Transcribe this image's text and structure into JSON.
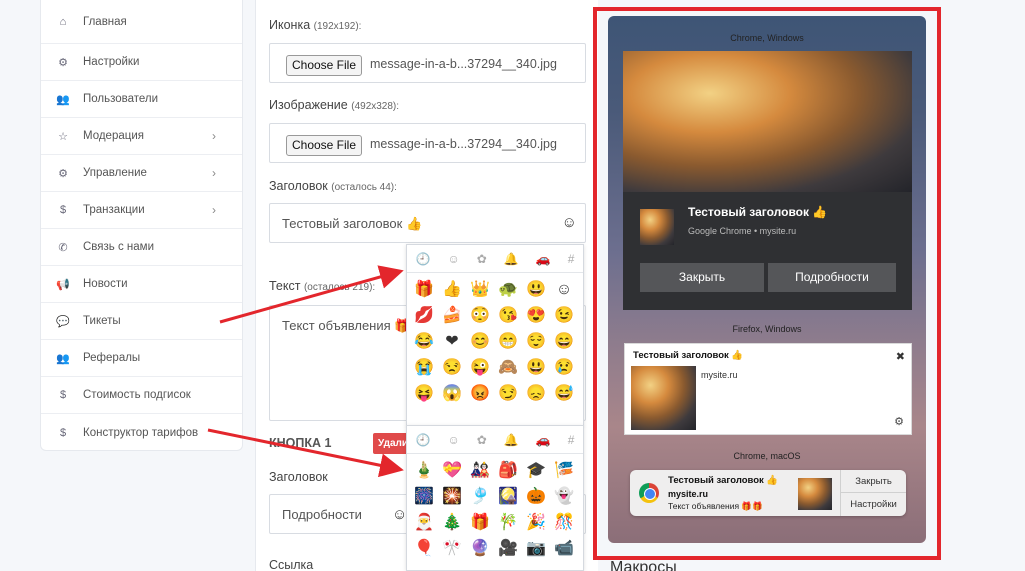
{
  "sidebar": {
    "items": [
      {
        "label": "Главная",
        "icon": "home-icon",
        "glyph": "⌂",
        "chevron": false
      },
      {
        "label": "Настройки",
        "icon": "gear-icon",
        "glyph": "⚙",
        "chevron": false
      },
      {
        "label": "Пользователи",
        "icon": "users-icon",
        "glyph": "👥",
        "chevron": false
      },
      {
        "label": "Модерация",
        "icon": "star-icon",
        "glyph": "☆",
        "chevron": true
      },
      {
        "label": "Управление",
        "icon": "gear-icon",
        "glyph": "⚙",
        "chevron": true
      },
      {
        "label": "Транзакции",
        "icon": "dollar-icon",
        "glyph": "$",
        "chevron": true
      },
      {
        "label": "Связь с нами",
        "icon": "phone-icon",
        "glyph": "✆",
        "chevron": false
      },
      {
        "label": "Новости",
        "icon": "megaphone-icon",
        "glyph": "📢",
        "chevron": false
      },
      {
        "label": "Тикеты",
        "icon": "chat-icon",
        "glyph": "💬",
        "chevron": false
      },
      {
        "label": "Рефералы",
        "icon": "users-icon",
        "glyph": "👥",
        "chevron": false
      },
      {
        "label": "Стоимость подгисок",
        "icon": "dollar-icon",
        "glyph": "$",
        "chevron": false
      },
      {
        "label": "Конструктор тарифов",
        "icon": "dollar-icon",
        "glyph": "$",
        "chevron": false
      }
    ],
    "chevron_glyph": "›"
  },
  "form": {
    "icon_label": "Иконка",
    "icon_hint": "(192x192):",
    "icon_button": "Choose File",
    "icon_filename": "message-in-a-b...37294__340.jpg",
    "image_label": "Изображение",
    "image_hint": "(492x328):",
    "image_button": "Choose File",
    "image_filename": "message-in-a-b...37294__340.jpg",
    "title_label": "Заголовок",
    "title_hint": "(осталось 44):",
    "title_value": "Тестовый заголовок 👍",
    "text_label": "Текст",
    "text_hint": "(осталось 219):",
    "text_value": "Текст объявления 🎁",
    "smile_glyph": "☺",
    "button_section": "КНОПКА 1",
    "delete_label": "Удалить",
    "btn_title_label": "Заголовок",
    "btn_title_value": "Подробности",
    "link_label": "Ссылка"
  },
  "picker1": {
    "tabs": [
      "🕘",
      "☺",
      "✿",
      "🔔",
      "🚗",
      "#"
    ],
    "active": 0,
    "emoji": [
      "🎁",
      "👍",
      "👑",
      "🐢",
      "😃",
      "☺",
      "💋",
      "🍰",
      "😳",
      "😘",
      "😍",
      "😉",
      "😂",
      "❤",
      "😊",
      "😁",
      "😌",
      "😄",
      "😭",
      "😒",
      "😜",
      "🙈",
      "😃",
      "😢",
      "😝",
      "😱",
      "😡",
      "😏",
      "😞",
      "😅"
    ]
  },
  "picker2": {
    "tabs": [
      "🕘",
      "☺",
      "✿",
      "🔔",
      "🚗",
      "#"
    ],
    "active": 3,
    "emoji": [
      "🎍",
      "💝",
      "🎎",
      "🎒",
      "🎓",
      "🎏",
      "🎆",
      "🎇",
      "🎐",
      "🎑",
      "🎃",
      "👻",
      "🎅",
      "🎄",
      "🎁",
      "🎋",
      "🎉",
      "🎊",
      "🎈",
      "🎌",
      "🔮",
      "🎥",
      "📷",
      "📹"
    ]
  },
  "preview": {
    "chrome_windows": {
      "caption": "Chrome, Windows",
      "title": "Тестовый заголовок 👍",
      "subtitle": "Google Chrome • mysite.ru",
      "close_label": "Закрыть",
      "details_label": "Подробности"
    },
    "firefox_windows": {
      "caption": "Firefox, Windows",
      "title": "Тестовый заголовок 👍",
      "site": "mysite.ru",
      "close_glyph": "✖",
      "gear_glyph": "⚙"
    },
    "chrome_macos": {
      "caption": "Chrome, macOS",
      "title": "Тестовый заголовок 👍",
      "site": "mysite.ru",
      "body": "Текст объявления 🎁🎁",
      "close_label": "Закрыть",
      "settings_label": "Настройки"
    },
    "frame_color": "#e3262c"
  },
  "footer": {
    "heading": "Макросы"
  }
}
